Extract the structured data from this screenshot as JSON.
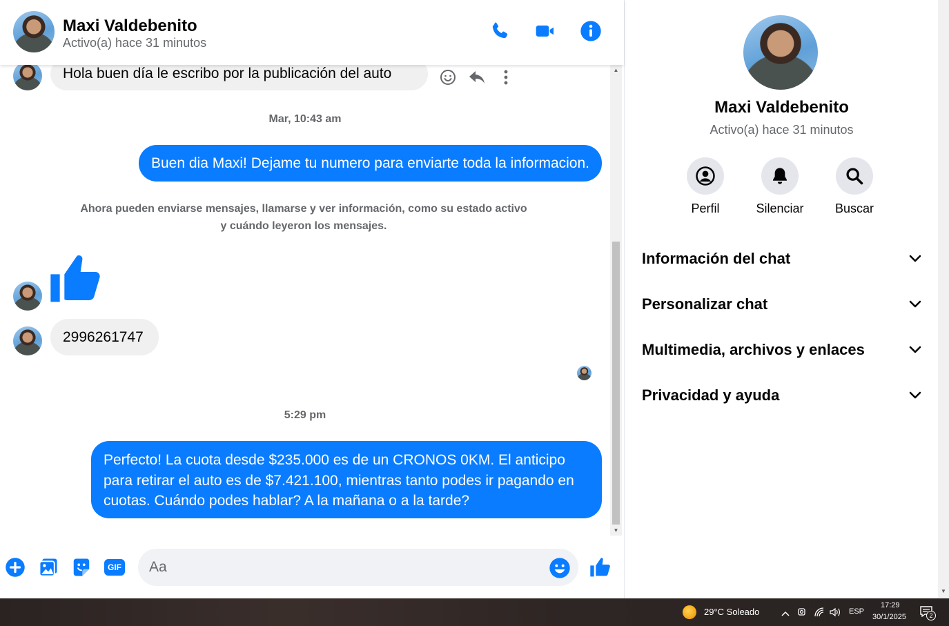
{
  "header": {
    "name": "Maxi Valdebenito",
    "status": "Activo(a) hace 31 minutos"
  },
  "colors": {
    "accent": "#0A7CFF",
    "bubble_in": "#F0F0F0",
    "muted_text": "#65676B"
  },
  "messages": {
    "first_incoming": "Hola buen día le escribo por la publicación del auto",
    "timestamp_1": "Mar, 10:43 am",
    "outgoing_1": "Buen dia Maxi! Dejame tu numero para enviarte toda la informacion.",
    "notice": "Ahora pueden enviarse mensajes, llamarse y ver información, como su estado activo y cuándo leyeron los mensajes.",
    "phone_reply": "2996261747",
    "timestamp_2": "5:29 pm",
    "outgoing_2": "Perfecto! La cuota desde $235.000 es de un CRONOS 0KM. El anticipo para retirar el auto es de $7.421.100, mientras tanto podes ir pagando en cuotas. Cuándo podes hablar? A la mañana o a la tarde?"
  },
  "composer": {
    "placeholder": "Aa",
    "gif_label": "GIF"
  },
  "side_panel": {
    "name": "Maxi Valdebenito",
    "status": "Activo(a) hace 31 minutos",
    "actions": [
      {
        "label": "Perfil",
        "icon": "profile-icon"
      },
      {
        "label": "Silenciar",
        "icon": "bell-icon"
      },
      {
        "label": "Buscar",
        "icon": "search-icon"
      }
    ],
    "sections": [
      {
        "label": "Información del chat"
      },
      {
        "label": "Personalizar chat"
      },
      {
        "label": "Multimedia, archivos y enlaces"
      },
      {
        "label": "Privacidad y ayuda"
      }
    ]
  },
  "taskbar": {
    "weather": "29°C  Soleado",
    "language": "ESP",
    "time": "17:29",
    "date": "30/1/2025",
    "notifications": "2"
  }
}
